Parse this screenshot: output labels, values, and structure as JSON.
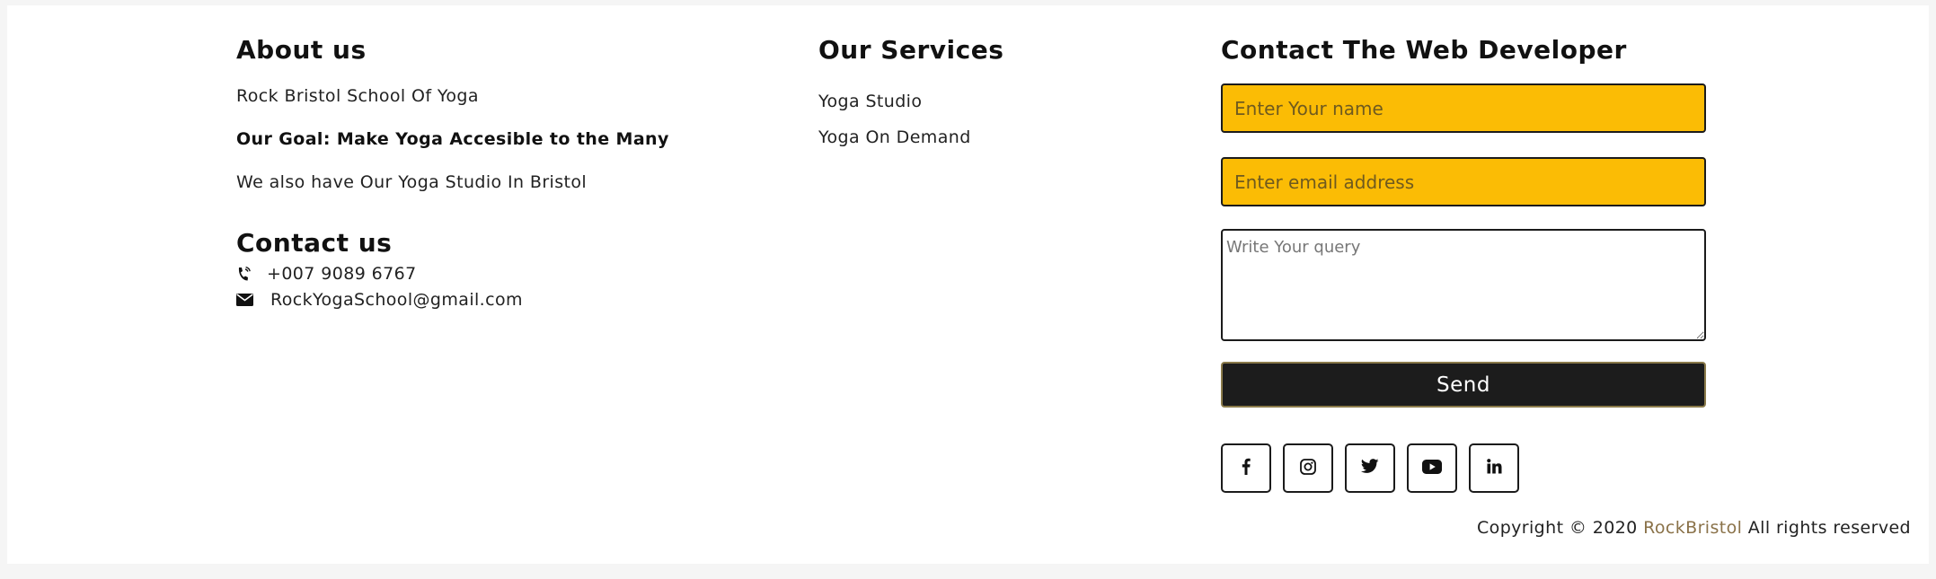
{
  "about": {
    "title": "About us",
    "line1": "Rock Bristol School Of Yoga",
    "goal": "Our Goal: Make Yoga Accesible to the Many",
    "line3": "We also have Our Yoga Studio In Bristol"
  },
  "contact": {
    "title": "Contact us",
    "phone": "+007 9089 6767",
    "email": "RockYogaSchool@gmail.com"
  },
  "services": {
    "title": "Our Services",
    "items": [
      "Yoga Studio",
      "Yoga On Demand"
    ]
  },
  "developer": {
    "title": "Contact The Web Developer",
    "name_placeholder": "Enter Your name",
    "email_placeholder": "Enter email address",
    "query_placeholder": "Write Your query",
    "send_label": "Send"
  },
  "socials": {
    "icons": [
      "facebook-icon",
      "instagram-icon",
      "twitter-icon",
      "youtube-icon",
      "linkedin-icon"
    ]
  },
  "copyright": {
    "prefix": "Copyright © 2020 ",
    "brand": "RockBristol",
    "suffix": " All rights reserved"
  },
  "colors": {
    "field_bg": "#fbbc05",
    "button_bg": "#1c1c1c",
    "brand": "#8a7249"
  }
}
